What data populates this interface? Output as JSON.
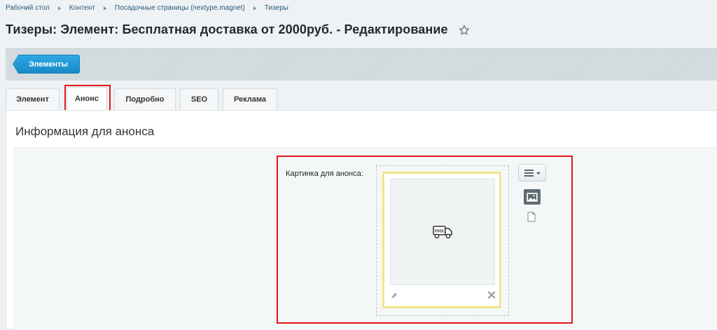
{
  "breadcrumb": {
    "items": [
      "Рабочий стол",
      "Контент",
      "Посадочные страницы (nextype.magnet)",
      "Тизеры"
    ]
  },
  "header": {
    "title": "Тизеры: Элемент: Бесплатная доставка от 2000руб. - Редактирование",
    "star_icon": "star-outline-icon"
  },
  "toolbar": {
    "elements_label": "Элементы",
    "accent_color": "#1a8fd0"
  },
  "tabs": [
    {
      "label": "Элемент",
      "active": false
    },
    {
      "label": "Анонс",
      "active": true
    },
    {
      "label": "Подробно",
      "active": false
    },
    {
      "label": "SEO",
      "active": false
    },
    {
      "label": "Реклама",
      "active": false
    }
  ],
  "section": {
    "title": "Информация для анонса"
  },
  "field": {
    "label": "Картинка для анонса:",
    "preview_icon": "free-delivery-truck-icon",
    "edit_icon": "pencil-icon",
    "remove_icon": "close-icon",
    "menu_icon": "menu-lines-icon",
    "image_mode_icon": "image-icon",
    "file_mode_icon": "file-icon"
  },
  "highlight_color": "#e3171b"
}
